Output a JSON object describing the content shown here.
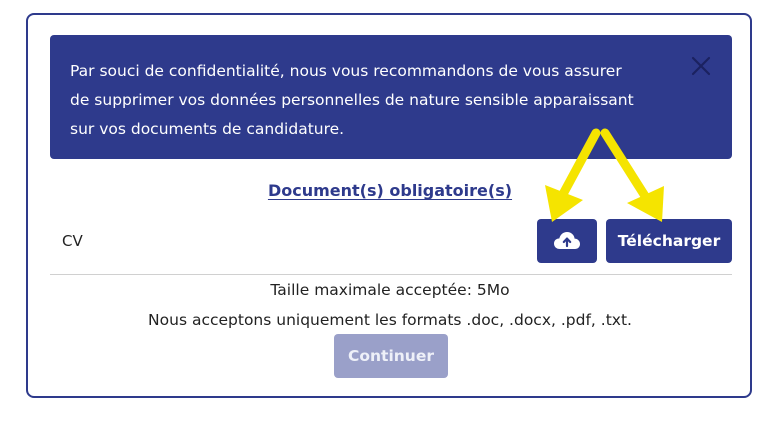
{
  "notice": {
    "lines": [
      "Par souci de confidentialité, nous vous recommandons de vous assurer",
      "de supprimer vos données personnelles de nature sensible apparaissant",
      "sur vos documents de candidature."
    ],
    "close_icon": "close-icon"
  },
  "section_title": "Document(s) obligatoire(s)",
  "document": {
    "label": "CV",
    "upload_icon": "cloud-upload-icon",
    "upload_label": "Télécharger"
  },
  "info": {
    "max_size": "Taille maximale acceptée: 5Mo",
    "formats": "Nous acceptons uniquement les formats .doc, .docx, .pdf, .txt."
  },
  "continue_label": "Continuer",
  "colors": {
    "primary": "#2e3a8c",
    "disabled": "#9aa0c9",
    "annotation_arrow": "#f5e400"
  }
}
